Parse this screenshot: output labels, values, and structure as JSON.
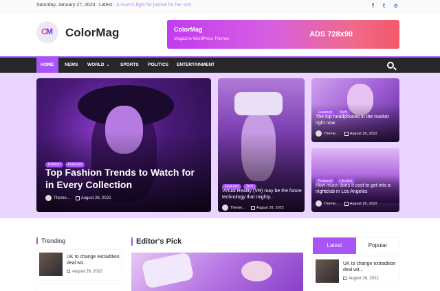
{
  "topbar": {
    "date": "Saturday, January 27, 2024",
    "latest_label": "Latest:",
    "latest_text": "A mum's fight for justice for her son",
    "social": [
      "f",
      "t",
      "o"
    ]
  },
  "header": {
    "logo_c": "C",
    "logo_m": "M",
    "site_name": "ColorMag",
    "ad": {
      "title": "ColorMag",
      "subtitle": "Magazine WordPress Themes",
      "size": "ADS 728x90",
      "gradient_start": "#c23bf0",
      "gradient_end": "#f4586a"
    }
  },
  "nav": {
    "items": [
      {
        "label": "Home",
        "active": true
      },
      {
        "label": "News"
      },
      {
        "label": "World",
        "dropdown": true
      },
      {
        "label": "Sports"
      },
      {
        "label": "Politics"
      },
      {
        "label": "Entertainment"
      }
    ],
    "search_icon": "search-icon"
  },
  "hero": {
    "main": {
      "tags": [
        "Fashion",
        "Featured"
      ],
      "title": "Top Fashion Trends to Watch for in Every Collection",
      "author": "Theme...",
      "date": "August 28, 2022"
    },
    "middle": {
      "tags": [
        "Featured",
        "Tech"
      ],
      "title": "Virtual Reality (VR) may be the future technology that mighty...",
      "author": "Theme...",
      "date": "August 28, 2022"
    },
    "right_top": {
      "tags": [
        "Featured",
        "Tech"
      ],
      "title": "The top headphones in the market right now",
      "author": "Theme...",
      "date": "August 28, 2022"
    },
    "right_bottom": {
      "tags": [
        "Featured",
        "Lifestyle"
      ],
      "title": "How much does it cost to get into a nightclub in Los Angeles",
      "author": "Theme...",
      "date": "August 28, 2022"
    }
  },
  "trending": {
    "heading": "Trending",
    "item": {
      "title": "UK to change extradition deal wit...",
      "date": "August 28, 2022"
    }
  },
  "editors_pick": {
    "heading": "Editor's Pick"
  },
  "sidebar": {
    "tab_latest": "Latest",
    "tab_popular": "Popular",
    "item": {
      "title": "UK to change extradition deal wit...",
      "date": "August 28, 2022"
    }
  },
  "colors": {
    "accent": "#a855f7",
    "nav_bg": "#27272a",
    "hero_bg": "#e9d5ff"
  }
}
